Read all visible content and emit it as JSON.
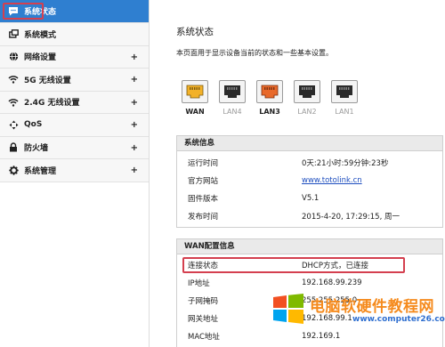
{
  "sidebar": {
    "items": [
      {
        "label": "系统状态",
        "icon": "chat-bubble-icon",
        "active": true,
        "expandable": false
      },
      {
        "label": "系统模式",
        "icon": "windows-icon",
        "expandable": false
      },
      {
        "label": "网络设置",
        "icon": "globe-icon",
        "expandable": true
      },
      {
        "label": "5G 无线设置",
        "icon": "wifi-icon",
        "expandable": true
      },
      {
        "label": "2.4G 无线设置",
        "icon": "wifi-icon",
        "expandable": true
      },
      {
        "label": "QoS",
        "icon": "qos-icon",
        "expandable": true
      },
      {
        "label": "防火墙",
        "icon": "lock-icon",
        "expandable": true
      },
      {
        "label": "系统管理",
        "icon": "gear-icon",
        "expandable": true
      }
    ],
    "expand_symbol": "+"
  },
  "main": {
    "title": "系统状态",
    "description": "本页面用于显示设备当前的状态和一些基本设置。",
    "ports": [
      {
        "label": "WAN",
        "state": "connected-wan"
      },
      {
        "label": "LAN4",
        "state": "off"
      },
      {
        "label": "LAN3",
        "state": "connected"
      },
      {
        "label": "LAN2",
        "state": "off"
      },
      {
        "label": "LAN1",
        "state": "off"
      }
    ]
  },
  "system_info": {
    "title": "系统信息",
    "rows": [
      {
        "key": "运行时间",
        "value": "0天:21小时:59分钟:23秒"
      },
      {
        "key": "官方网站",
        "value": "www.totolink.cn"
      },
      {
        "key": "固件版本",
        "value": "V5.1"
      },
      {
        "key": "发布时间",
        "value": "2015-4-20, 17:29:15, 周一"
      }
    ]
  },
  "wan_info": {
    "title": "WAN配置信息",
    "rows": [
      {
        "key": "连接状态",
        "value": "DHCP方式，已连接"
      },
      {
        "key": "IP地址",
        "value": "192.168.99.239"
      },
      {
        "key": "子网掩码",
        "value": "255.255.255.0"
      },
      {
        "key": "网关地址",
        "value": "192.168.99.1"
      },
      {
        "key": "MAC地址",
        "value": "192.169.1"
      }
    ]
  },
  "watermark": {
    "title": "电脑软硬件教程网",
    "url": "www.computer26.com"
  },
  "colors": {
    "active_nav": "#2f7fd0",
    "highlight_border": "#d4404f",
    "wan_port": "#f2b128",
    "lan_active_port": "#e8692a",
    "link": "#1f4fbf"
  }
}
